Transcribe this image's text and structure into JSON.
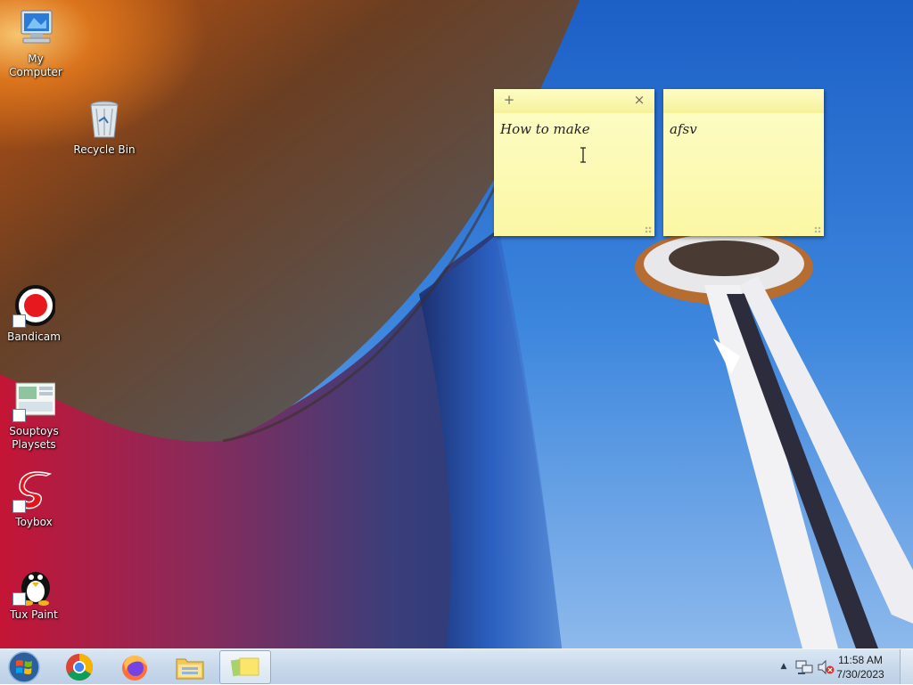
{
  "desktop_icons": [
    {
      "label": "My Computer",
      "icon": "computer-icon"
    },
    {
      "label": "Recycle Bin",
      "icon": "recycle-bin-icon"
    },
    {
      "label": "Bandicam",
      "icon": "bandicam-icon"
    },
    {
      "label": "Souptoys\nPlaysets",
      "icon": "souptoys-icon"
    },
    {
      "label": "Toybox",
      "icon": "toybox-icon"
    },
    {
      "label": "Tux Paint",
      "icon": "tux-paint-icon"
    }
  ],
  "sticky_notes": [
    {
      "text": "How to make",
      "add_glyph": "+",
      "close_glyph": "×"
    },
    {
      "text": "afsv"
    }
  ],
  "taskbar": {
    "start_icon": "windows-start-icon",
    "pinned": [
      "chrome-icon",
      "firefox-icon",
      "file-explorer-icon",
      "sticky-notes-icon"
    ],
    "tray": {
      "overflow_glyph": "▲",
      "time": "11:58 AM",
      "date": "7/30/2023"
    }
  },
  "colors": {
    "sticky_yellow": "#fbf7a4",
    "taskbar": "#c8d9ec",
    "sky": "#3d86dc"
  }
}
